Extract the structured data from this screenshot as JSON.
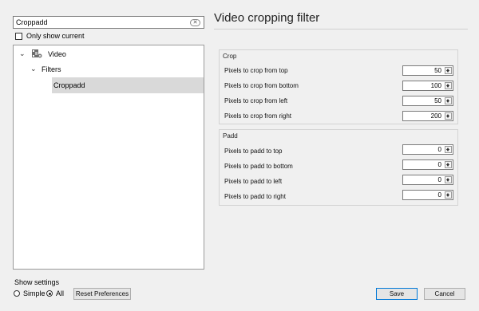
{
  "search": {
    "value": "Croppadd",
    "clear_icon": "clear-icon"
  },
  "only_show_current": {
    "label": "Only show current",
    "checked": false
  },
  "tree": {
    "video": {
      "label": "Video",
      "icon": "video-settings-icon"
    },
    "filters": {
      "label": "Filters"
    },
    "croppadd": {
      "label": "Croppadd",
      "selected": true
    }
  },
  "panel": {
    "title": "Video cropping filter",
    "crop": {
      "title": "Crop",
      "rows": [
        {
          "label": "Pixels to crop from top",
          "value": "50"
        },
        {
          "label": "Pixels to crop from bottom",
          "value": "100"
        },
        {
          "label": "Pixels to crop from left",
          "value": "50"
        },
        {
          "label": "Pixels to crop from right",
          "value": "200"
        }
      ]
    },
    "padd": {
      "title": "Padd",
      "rows": [
        {
          "label": "Pixels to padd to top",
          "value": "0"
        },
        {
          "label": "Pixels to padd to bottom",
          "value": "0"
        },
        {
          "label": "Pixels to padd to left",
          "value": "0"
        },
        {
          "label": "Pixels to padd to right",
          "value": "0"
        }
      ]
    }
  },
  "bottom": {
    "show_settings": "Show settings",
    "simple": "Simple",
    "all": "All",
    "selected_mode": "All",
    "reset": "Reset Preferences",
    "save": "Save",
    "cancel": "Cancel"
  }
}
